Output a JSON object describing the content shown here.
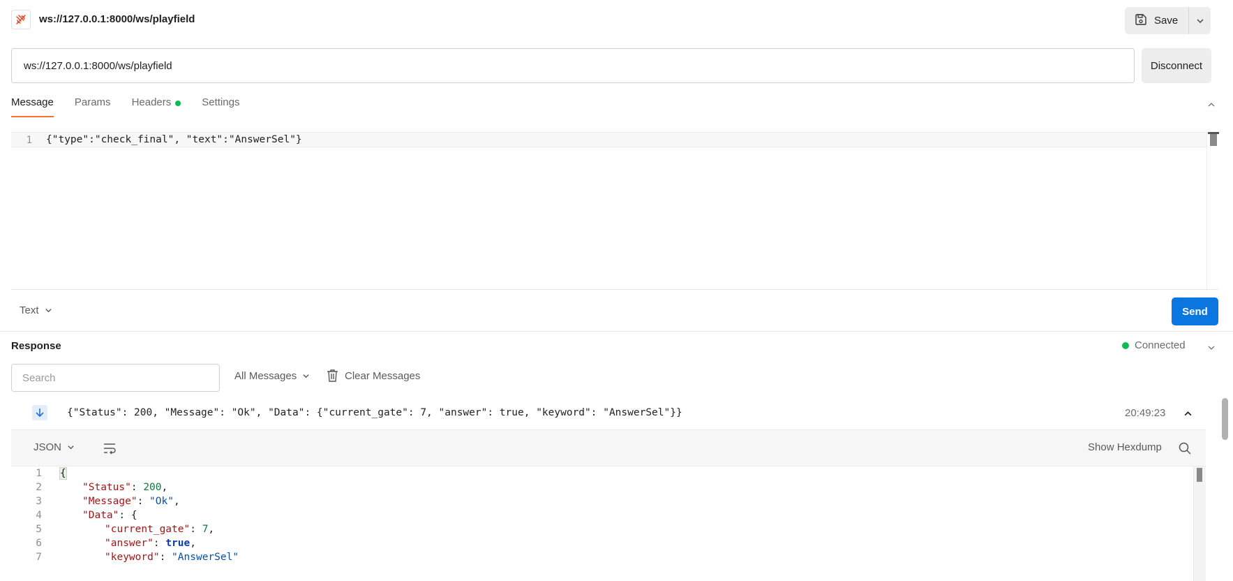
{
  "header": {
    "title": "ws://127.0.0.1:8000/ws/playfield",
    "save_label": "Save"
  },
  "url_bar": {
    "value": "ws://127.0.0.1:8000/ws/playfield",
    "disconnect_label": "Disconnect"
  },
  "tabs": [
    {
      "label": "Message",
      "active": true
    },
    {
      "label": "Params",
      "active": false
    },
    {
      "label": "Headers",
      "active": false,
      "indicator": "green-dot"
    },
    {
      "label": "Settings",
      "active": false
    }
  ],
  "editor": {
    "line_number": "1",
    "content": "{\"type\":\"check_final\", \"text\":\"AnswerSel\"}"
  },
  "composer": {
    "format_label": "Text",
    "send_label": "Send"
  },
  "response": {
    "title": "Response",
    "status": "Connected",
    "status_color": "#0cbb52",
    "search_placeholder": "Search",
    "filter_label": "All Messages",
    "clear_label": "Clear Messages",
    "message": {
      "direction_icon": "arrow-down-icon",
      "text": "{\"Status\": 200, \"Message\": \"Ok\", \"Data\": {\"current_gate\": 7, \"answer\": true, \"keyword\": \"AnswerSel\"}}",
      "time": "20:49:23"
    },
    "viewer": {
      "format_label": "JSON",
      "hexdump_label": "Show Hexdump",
      "line_numbers": [
        "1",
        "2",
        "3",
        "4",
        "5",
        "6",
        "7"
      ],
      "lines": {
        "l1": "{",
        "l2_key": "\"Status\"",
        "l2_val": "200",
        "l3_key": "\"Message\"",
        "l3_val": "\"Ok\"",
        "l4_key": "\"Data\"",
        "l5_key": "\"current_gate\"",
        "l5_val": "7",
        "l6_key": "\"answer\"",
        "l6_val": "true",
        "l7_key": "\"keyword\"",
        "l7_val": "\"AnswerSel\""
      }
    }
  },
  "colors": {
    "accent": "#ff6c37",
    "send_button": "#0b76e0"
  }
}
